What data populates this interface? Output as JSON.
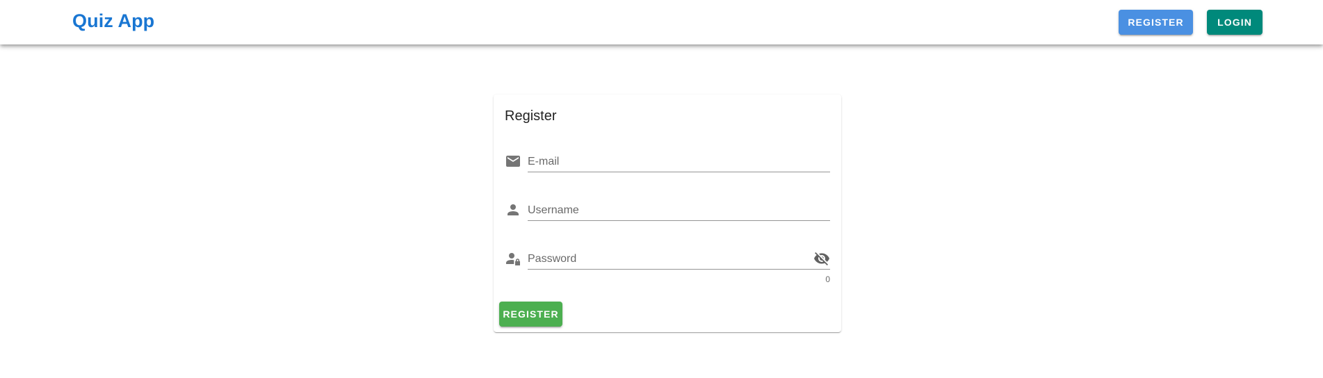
{
  "header": {
    "brand": "Quiz App",
    "register_label": "REGISTER",
    "login_label": "LOGIN"
  },
  "form": {
    "title": "Register",
    "email": {
      "value": "",
      "placeholder": "E-mail",
      "icon": "email-icon"
    },
    "username": {
      "value": "",
      "placeholder": "Username",
      "icon": "account-icon"
    },
    "password": {
      "value": "",
      "placeholder": "Password",
      "icon": "account-lock-icon",
      "toggle_icon": "eye-off-icon",
      "counter": "0"
    },
    "submit_label": "REGISTER"
  },
  "colors": {
    "brand": "#1976d2",
    "register_button": "#4a90e2",
    "login_button": "#00897b",
    "submit_button": "#4caf50",
    "icon": "#757575"
  }
}
